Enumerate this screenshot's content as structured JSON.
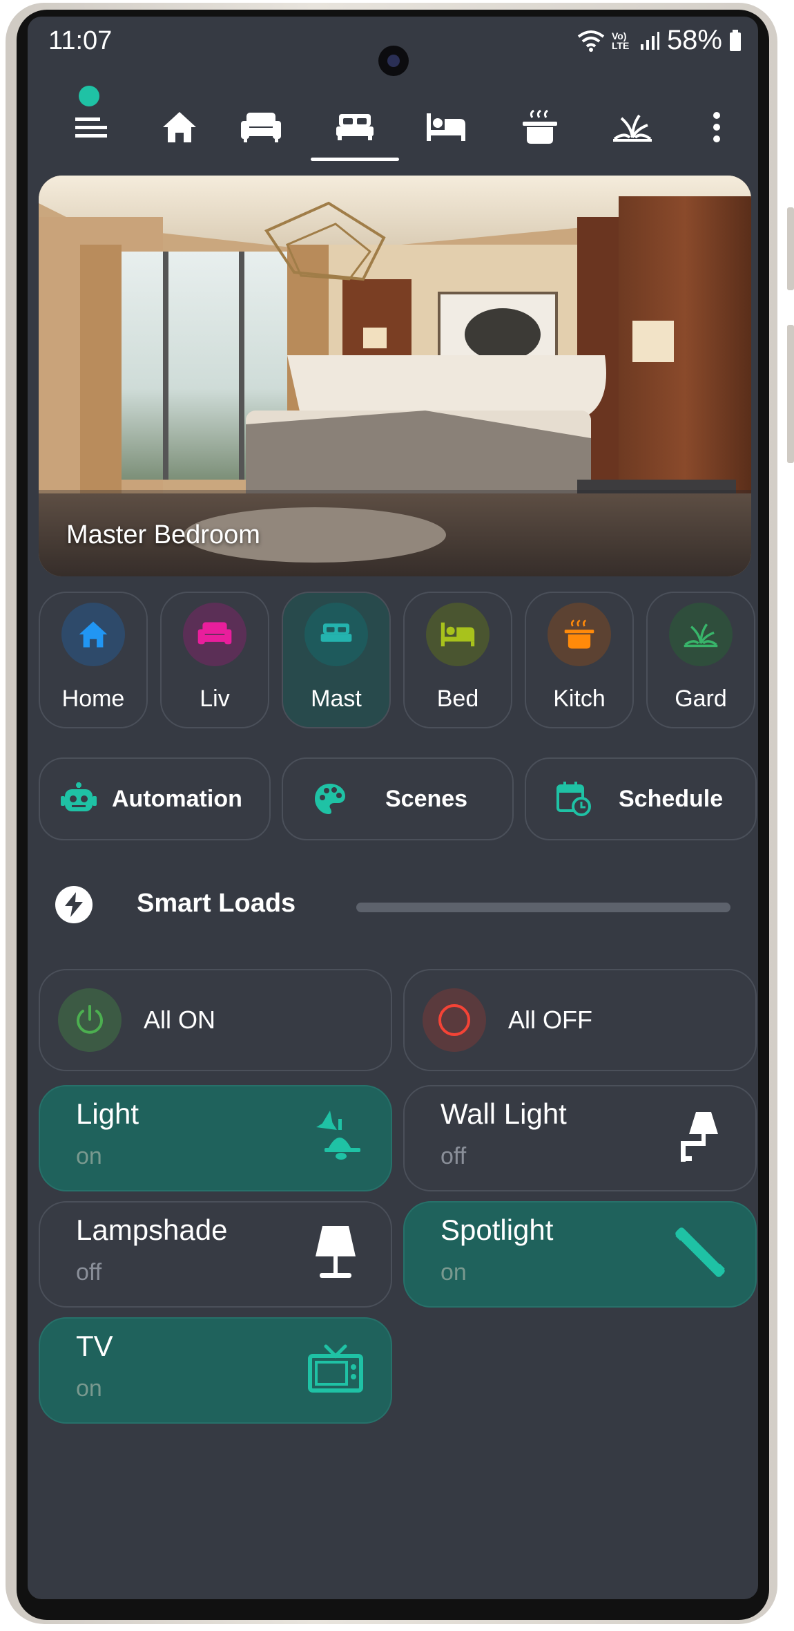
{
  "status_bar": {
    "time": "11:07",
    "battery": "58%",
    "network_label": "Vo) LTE"
  },
  "nav": {
    "tabs": [
      {
        "icon": "menu-icon"
      },
      {
        "icon": "home-icon"
      },
      {
        "icon": "sofa-icon"
      },
      {
        "icon": "bed-icon",
        "selected": true
      },
      {
        "icon": "single-bed-icon"
      },
      {
        "icon": "pot-icon"
      },
      {
        "icon": "plant-icon"
      },
      {
        "icon": "more-vert-icon"
      }
    ]
  },
  "hero": {
    "room_title": "Master Bedroom"
  },
  "rooms": [
    {
      "label": "Home",
      "icon": "home-icon",
      "color": "#2196f3"
    },
    {
      "label": "Liv",
      "icon": "sofa-icon",
      "color": "#e91e9c"
    },
    {
      "label": "Mast",
      "icon": "bed-icon",
      "color": "#24b3ae",
      "selected": true
    },
    {
      "label": "Bed",
      "icon": "single-bed-icon",
      "color": "#a8c21c"
    },
    {
      "label": "Kitch",
      "icon": "pot-icon",
      "color": "#ff8a0a"
    },
    {
      "label": "Gard",
      "icon": "plant-icon",
      "color": "#38b56a"
    }
  ],
  "actions": [
    {
      "label": "Automation",
      "icon": "robot-icon"
    },
    {
      "label": "Scenes",
      "icon": "palette-icon"
    },
    {
      "label": "Schedule",
      "icon": "calendar-clock-icon"
    }
  ],
  "smart_loads": {
    "title": "Smart Loads",
    "icon": "lightning-icon"
  },
  "all_on": {
    "label": "All ON",
    "color": "#4caf50"
  },
  "all_off": {
    "label": "All OFF",
    "color": "#f44336"
  },
  "loads": [
    {
      "name": "Light",
      "state": "on",
      "icon": "ceiling-light-icon"
    },
    {
      "name": "Wall Light",
      "state": "off",
      "icon": "wall-lamp-icon"
    },
    {
      "name": "Lampshade",
      "state": "off",
      "icon": "table-lamp-icon"
    },
    {
      "name": "Spotlight",
      "state": "on",
      "icon": "spotlight-icon"
    },
    {
      "name": "TV",
      "state": "on",
      "icon": "tv-icon"
    }
  ],
  "colors": {
    "accent": "#1fc2a5",
    "background": "#363a43",
    "tile_on": "#1f625c"
  }
}
